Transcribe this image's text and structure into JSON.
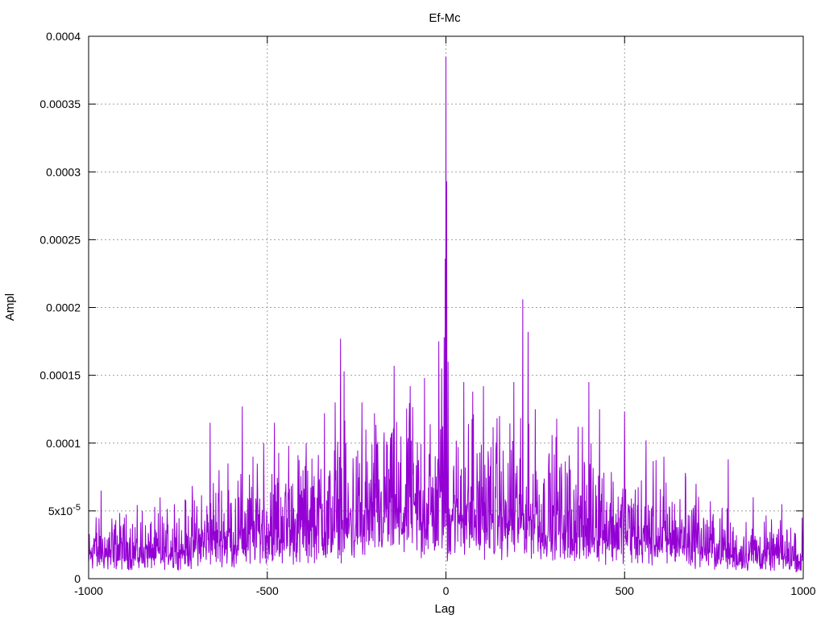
{
  "chart_data": {
    "type": "line",
    "title": "Ef-Mc",
    "xlabel": "Lag",
    "ylabel": "Ampl",
    "xlim": [
      -1000,
      1000
    ],
    "ylim": [
      0,
      0.0004
    ],
    "grid": true,
    "x_ticks": [
      {
        "value": -1000,
        "label": "-1000"
      },
      {
        "value": -500,
        "label": "-500"
      },
      {
        "value": 0,
        "label": "0"
      },
      {
        "value": 500,
        "label": "500"
      },
      {
        "value": 1000,
        "label": "1000"
      }
    ],
    "y_ticks": [
      {
        "value": 0,
        "label": "0"
      },
      {
        "value": 5e-05,
        "label": "5x10",
        "exp": "-5"
      },
      {
        "value": 0.0001,
        "label": "0.0001"
      },
      {
        "value": 0.00015,
        "label": "0.00015"
      },
      {
        "value": 0.0002,
        "label": "0.0002"
      },
      {
        "value": 0.00025,
        "label": "0.00025"
      },
      {
        "value": 0.0003,
        "label": "0.0003"
      },
      {
        "value": 0.00035,
        "label": "0.00035"
      },
      {
        "value": 0.0004,
        "label": "0.0004"
      }
    ],
    "series_color": "#9400d3",
    "peaks": [
      [
        -1010,
        3.5e-05
      ],
      [
        -995,
        2e-05
      ],
      [
        -985,
        3e-05
      ],
      [
        -965,
        6.5e-05
      ],
      [
        -900,
        4.5e-05
      ],
      [
        -850,
        5e-05
      ],
      [
        -800,
        6e-05
      ],
      [
        -760,
        5.5e-05
      ],
      [
        -660,
        0.000115
      ],
      [
        -635,
        8e-05
      ],
      [
        -610,
        8.5e-05
      ],
      [
        -570,
        0.000127
      ],
      [
        -540,
        9e-05
      ],
      [
        -510,
        0.0001
      ],
      [
        -480,
        0.000115
      ],
      [
        -440,
        9.8e-05
      ],
      [
        -400,
        8e-05
      ],
      [
        -340,
        0.000122
      ],
      [
        -310,
        0.00013
      ],
      [
        -295,
        0.000177
      ],
      [
        -285,
        0.000153
      ],
      [
        -235,
        0.00013
      ],
      [
        -200,
        0.000122
      ],
      [
        -145,
        0.000157
      ],
      [
        -100,
        0.000142
      ],
      [
        -60,
        0.000148
      ],
      [
        -20,
        0.000175
      ],
      [
        -12,
        0.000155
      ],
      [
        -5,
        0.000178
      ],
      [
        -2,
        0.000236
      ],
      [
        0,
        0.000385
      ],
      [
        2,
        0.000293
      ],
      [
        6,
        0.00016
      ],
      [
        50,
        0.000145
      ],
      [
        75,
        0.000138
      ],
      [
        105,
        0.000142
      ],
      [
        150,
        0.00012
      ],
      [
        190,
        0.000145
      ],
      [
        215,
        0.000206
      ],
      [
        230,
        0.000182
      ],
      [
        250,
        0.000125
      ],
      [
        310,
        0.000118
      ],
      [
        370,
        0.000112
      ],
      [
        400,
        0.000145
      ],
      [
        430,
        0.000125
      ],
      [
        500,
        0.000123
      ],
      [
        560,
        0.000102
      ],
      [
        610,
        9e-05
      ],
      [
        670,
        7.8e-05
      ],
      [
        700,
        7e-05
      ],
      [
        790,
        8.8e-05
      ],
      [
        860,
        6e-05
      ],
      [
        940,
        5.5e-05
      ],
      [
        1000,
        3.5e-05
      ]
    ],
    "envelope": [
      [
        -1010,
        3e-05
      ],
      [
        -800,
        3e-05
      ],
      [
        -650,
        4.5e-05
      ],
      [
        -400,
        6e-05
      ],
      [
        -200,
        7e-05
      ],
      [
        0,
        8e-05
      ],
      [
        200,
        7e-05
      ],
      [
        400,
        6e-05
      ],
      [
        650,
        4.5e-05
      ],
      [
        800,
        3e-05
      ],
      [
        1010,
        2.5e-05
      ]
    ]
  }
}
